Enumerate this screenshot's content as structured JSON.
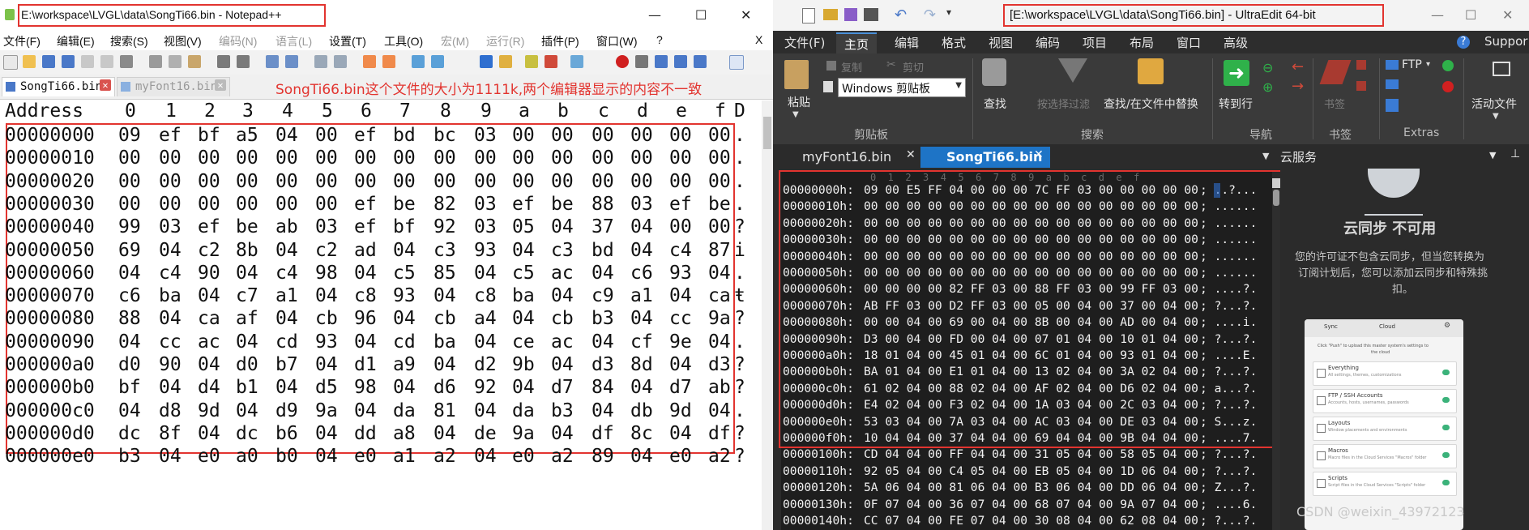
{
  "npp": {
    "title": "E:\\workspace\\LVGL\\data\\SongTi66.bin - Notepad++",
    "controls": {
      "minimize": "—",
      "maximize": "☐",
      "close": "✕"
    },
    "menu": [
      {
        "label": "文件(F)",
        "enabled": true
      },
      {
        "label": "编辑(E)",
        "enabled": true
      },
      {
        "label": "搜索(S)",
        "enabled": true
      },
      {
        "label": "视图(V)",
        "enabled": true
      },
      {
        "label": "编码(N)",
        "enabled": false
      },
      {
        "label": "语言(L)",
        "enabled": false
      },
      {
        "label": "设置(T)",
        "enabled": true
      },
      {
        "label": "工具(O)",
        "enabled": true
      },
      {
        "label": "宏(M)",
        "enabled": false
      },
      {
        "label": "运行(R)",
        "enabled": false
      },
      {
        "label": "插件(P)",
        "enabled": true
      },
      {
        "label": "窗口(W)",
        "enabled": true
      },
      {
        "label": "?",
        "enabled": true
      }
    ],
    "menu_close": "X",
    "tabs": [
      {
        "label": "SongTi66.bin",
        "active": true
      },
      {
        "label": "myFont16.bin",
        "active": false
      }
    ],
    "annotation": "SongTi66.bin这个文件的大小为1111k,两个编辑器显示的内容不一致",
    "hex": {
      "header": {
        "address": "Address",
        "cols": [
          "0",
          "1",
          "2",
          "3",
          "4",
          "5",
          "6",
          "7",
          "8",
          "9",
          "a",
          "b",
          "c",
          "d",
          "e",
          "f"
        ],
        "dump_col": "D"
      },
      "rows": [
        {
          "addr": "00000000",
          "bytes": [
            "09",
            "ef",
            "bf",
            "a5",
            "04",
            "00",
            "ef",
            "bd",
            "bc",
            "03",
            "00",
            "00",
            "00",
            "00",
            "00",
            "00"
          ],
          "ascii": "."
        },
        {
          "addr": "00000010",
          "bytes": [
            "00",
            "00",
            "00",
            "00",
            "00",
            "00",
            "00",
            "00",
            "00",
            "00",
            "00",
            "00",
            "00",
            "00",
            "00",
            "00"
          ],
          "ascii": "."
        },
        {
          "addr": "00000020",
          "bytes": [
            "00",
            "00",
            "00",
            "00",
            "00",
            "00",
            "00",
            "00",
            "00",
            "00",
            "00",
            "00",
            "00",
            "00",
            "00",
            "00"
          ],
          "ascii": "."
        },
        {
          "addr": "00000030",
          "bytes": [
            "00",
            "00",
            "00",
            "00",
            "00",
            "00",
            "ef",
            "be",
            "82",
            "03",
            "ef",
            "be",
            "88",
            "03",
            "ef",
            "be"
          ],
          "ascii": "."
        },
        {
          "addr": "00000040",
          "bytes": [
            "99",
            "03",
            "ef",
            "be",
            "ab",
            "03",
            "ef",
            "bf",
            "92",
            "03",
            "05",
            "04",
            "37",
            "04",
            "00",
            "00"
          ],
          "ascii": "?"
        },
        {
          "addr": "00000050",
          "bytes": [
            "69",
            "04",
            "c2",
            "8b",
            "04",
            "c2",
            "ad",
            "04",
            "c3",
            "93",
            "04",
            "c3",
            "bd",
            "04",
            "c4",
            "87"
          ],
          "ascii": "i"
        },
        {
          "addr": "00000060",
          "bytes": [
            "04",
            "c4",
            "90",
            "04",
            "c4",
            "98",
            "04",
            "c5",
            "85",
            "04",
            "c5",
            "ac",
            "04",
            "c6",
            "93",
            "04"
          ],
          "ascii": "."
        },
        {
          "addr": "00000070",
          "bytes": [
            "c6",
            "ba",
            "04",
            "c7",
            "a1",
            "04",
            "c8",
            "93",
            "04",
            "c8",
            "ba",
            "04",
            "c9",
            "a1",
            "04",
            "ca"
          ],
          "ascii": "ŧ"
        },
        {
          "addr": "00000080",
          "bytes": [
            "88",
            "04",
            "ca",
            "af",
            "04",
            "cb",
            "96",
            "04",
            "cb",
            "a4",
            "04",
            "cb",
            "b3",
            "04",
            "cc",
            "9a"
          ],
          "ascii": "?"
        },
        {
          "addr": "00000090",
          "bytes": [
            "04",
            "cc",
            "ac",
            "04",
            "cd",
            "93",
            "04",
            "cd",
            "ba",
            "04",
            "ce",
            "ac",
            "04",
            "cf",
            "9e",
            "04"
          ],
          "ascii": "."
        },
        {
          "addr": "000000a0",
          "bytes": [
            "d0",
            "90",
            "04",
            "d0",
            "b7",
            "04",
            "d1",
            "a9",
            "04",
            "d2",
            "9b",
            "04",
            "d3",
            "8d",
            "04",
            "d3"
          ],
          "ascii": "?"
        },
        {
          "addr": "000000b0",
          "bytes": [
            "bf",
            "04",
            "d4",
            "b1",
            "04",
            "d5",
            "98",
            "04",
            "d6",
            "92",
            "04",
            "d7",
            "84",
            "04",
            "d7",
            "ab"
          ],
          "ascii": "?"
        },
        {
          "addr": "000000c0",
          "bytes": [
            "04",
            "d8",
            "9d",
            "04",
            "d9",
            "9a",
            "04",
            "da",
            "81",
            "04",
            "da",
            "b3",
            "04",
            "db",
            "9d",
            "04"
          ],
          "ascii": "."
        },
        {
          "addr": "000000d0",
          "bytes": [
            "dc",
            "8f",
            "04",
            "dc",
            "b6",
            "04",
            "dd",
            "a8",
            "04",
            "de",
            "9a",
            "04",
            "df",
            "8c",
            "04",
            "df"
          ],
          "ascii": "?"
        },
        {
          "addr": "000000e0",
          "bytes": [
            "b3",
            "04",
            "e0",
            "a0",
            "b0",
            "04",
            "e0",
            "a1",
            "a2",
            "04",
            "e0",
            "a2",
            "89",
            "04",
            "e0",
            "a2"
          ],
          "ascii": "?"
        }
      ]
    }
  },
  "ue": {
    "title": "[E:\\workspace\\LVGL\\data\\SongTi66.bin] - UltraEdit 64-bit",
    "ribbon_tabs": [
      "文件(F)",
      "主页",
      "编辑",
      "格式",
      "视图",
      "编码",
      "项目",
      "布局",
      "窗口",
      "高级"
    ],
    "ribbon_right": "Suppor",
    "ribbon": {
      "copy": "复制",
      "cut": "剪切",
      "paste": "粘贴",
      "clipboard_select": "Windows 剪贴板",
      "group_clipboard": "剪贴板",
      "find": "查找",
      "filter": "按选择过滤",
      "find_in_files": "查找/在文件中替换",
      "group_search": "搜索",
      "goto": "转到行",
      "group_nav": "导航",
      "bookmark": "书签",
      "group_bookmark": "书签",
      "ftp": "FTP",
      "group_extras": "Extras",
      "active_file": "活动文件"
    },
    "doc_tabs": [
      {
        "label": "myFont16.bin",
        "active": false
      },
      {
        "label": "SongTi66.bin",
        "active": true
      }
    ],
    "cloud_panel_title": "云服务",
    "cloud": {
      "heading": "云同步 不可用",
      "msg1": "您的许可证不包含云同步，但当您转换为",
      "msg2": "订阅计划后，您可以添加云同步和特殊挑",
      "msg3": "扣。",
      "card_tab1": "Sync",
      "card_tab2": "Cloud",
      "card_desc1": "Click \"Push\" to upload this master system's settings to",
      "card_desc2": "the cloud",
      "items": [
        {
          "title": "Everything",
          "sub": "All settings, themes, customizations"
        },
        {
          "title": "FTP / SSH Accounts",
          "sub": "Accounts, hosts, usernames, passwords"
        },
        {
          "title": "Layouts",
          "sub": "Window placements and environments"
        },
        {
          "title": "Macros",
          "sub": "Macro files in the Cloud Services \"Macros\" folder"
        },
        {
          "title": "Scripts",
          "sub": "Script files in the Cloud Services \"Scripts\" folder"
        }
      ]
    },
    "hex": {
      "col_header": "0  1  2  3  4  5  6  7  8  9  a  b  c  d  e  f",
      "rows": [
        {
          "addr": "00000000h:",
          "bytes": "09 00 E5 FF 04 00 00 00 7C FF 03 00 00 00 00 00",
          "ascii": "; ..?..."
        },
        {
          "addr": "00000010h:",
          "bytes": "00 00 00 00 00 00 00 00 00 00 00 00 00 00 00 00",
          "ascii": "; ......"
        },
        {
          "addr": "00000020h:",
          "bytes": "00 00 00 00 00 00 00 00 00 00 00 00 00 00 00 00",
          "ascii": "; ......"
        },
        {
          "addr": "00000030h:",
          "bytes": "00 00 00 00 00 00 00 00 00 00 00 00 00 00 00 00",
          "ascii": "; ......"
        },
        {
          "addr": "00000040h:",
          "bytes": "00 00 00 00 00 00 00 00 00 00 00 00 00 00 00 00",
          "ascii": "; ......"
        },
        {
          "addr": "00000050h:",
          "bytes": "00 00 00 00 00 00 00 00 00 00 00 00 00 00 00 00",
          "ascii": "; ......"
        },
        {
          "addr": "00000060h:",
          "bytes": "00 00 00 00 82 FF 03 00 88 FF 03 00 99 FF 03 00",
          "ascii": "; ....?."
        },
        {
          "addr": "00000070h:",
          "bytes": "AB FF 03 00 D2 FF 03 00 05 00 04 00 37 00 04 00",
          "ascii": "; ?...?."
        },
        {
          "addr": "00000080h:",
          "bytes": "00 00 04 00 69 00 04 00 8B 00 04 00 AD 00 04 00",
          "ascii": "; ....i."
        },
        {
          "addr": "00000090h:",
          "bytes": "D3 00 04 00 FD 00 04 00 07 01 04 00 10 01 04 00",
          "ascii": "; ?...?."
        },
        {
          "addr": "000000a0h:",
          "bytes": "18 01 04 00 45 01 04 00 6C 01 04 00 93 01 04 00",
          "ascii": "; ....E."
        },
        {
          "addr": "000000b0h:",
          "bytes": "BA 01 04 00 E1 01 04 00 13 02 04 00 3A 02 04 00",
          "ascii": "; ?...?."
        },
        {
          "addr": "000000c0h:",
          "bytes": "61 02 04 00 88 02 04 00 AF 02 04 00 D6 02 04 00",
          "ascii": "; a...?."
        },
        {
          "addr": "000000d0h:",
          "bytes": "E4 02 04 00 F3 02 04 00 1A 03 04 00 2C 03 04 00",
          "ascii": "; ?...?."
        },
        {
          "addr": "000000e0h:",
          "bytes": "53 03 04 00 7A 03 04 00 AC 03 04 00 DE 03 04 00",
          "ascii": "; S...z."
        },
        {
          "addr": "000000f0h:",
          "bytes": "10 04 04 00 37 04 04 00 69 04 04 00 9B 04 04 00",
          "ascii": "; ....7."
        },
        {
          "addr": "00000100h:",
          "bytes": "CD 04 04 00 FF 04 04 00 31 05 04 00 58 05 04 00",
          "ascii": "; ?...?."
        },
        {
          "addr": "00000110h:",
          "bytes": "92 05 04 00 C4 05 04 00 EB 05 04 00 1D 06 04 00",
          "ascii": "; ?...?."
        },
        {
          "addr": "00000120h:",
          "bytes": "5A 06 04 00 81 06 04 00 B3 06 04 00 DD 06 04 00",
          "ascii": "; Z...?."
        },
        {
          "addr": "00000130h:",
          "bytes": "0F 07 04 00 36 07 04 00 68 07 04 00 9A 07 04 00",
          "ascii": "; ....6."
        },
        {
          "addr": "00000140h:",
          "bytes": "CC 07 04 00 FE 07 04 00 30 08 04 00 62 08 04 00",
          "ascii": "; ?...?."
        }
      ]
    }
  },
  "watermark": "CSDN @weixin_43972123",
  "colors": {
    "highlight": "#e2342f",
    "ue_accent": "#4a90d9"
  }
}
